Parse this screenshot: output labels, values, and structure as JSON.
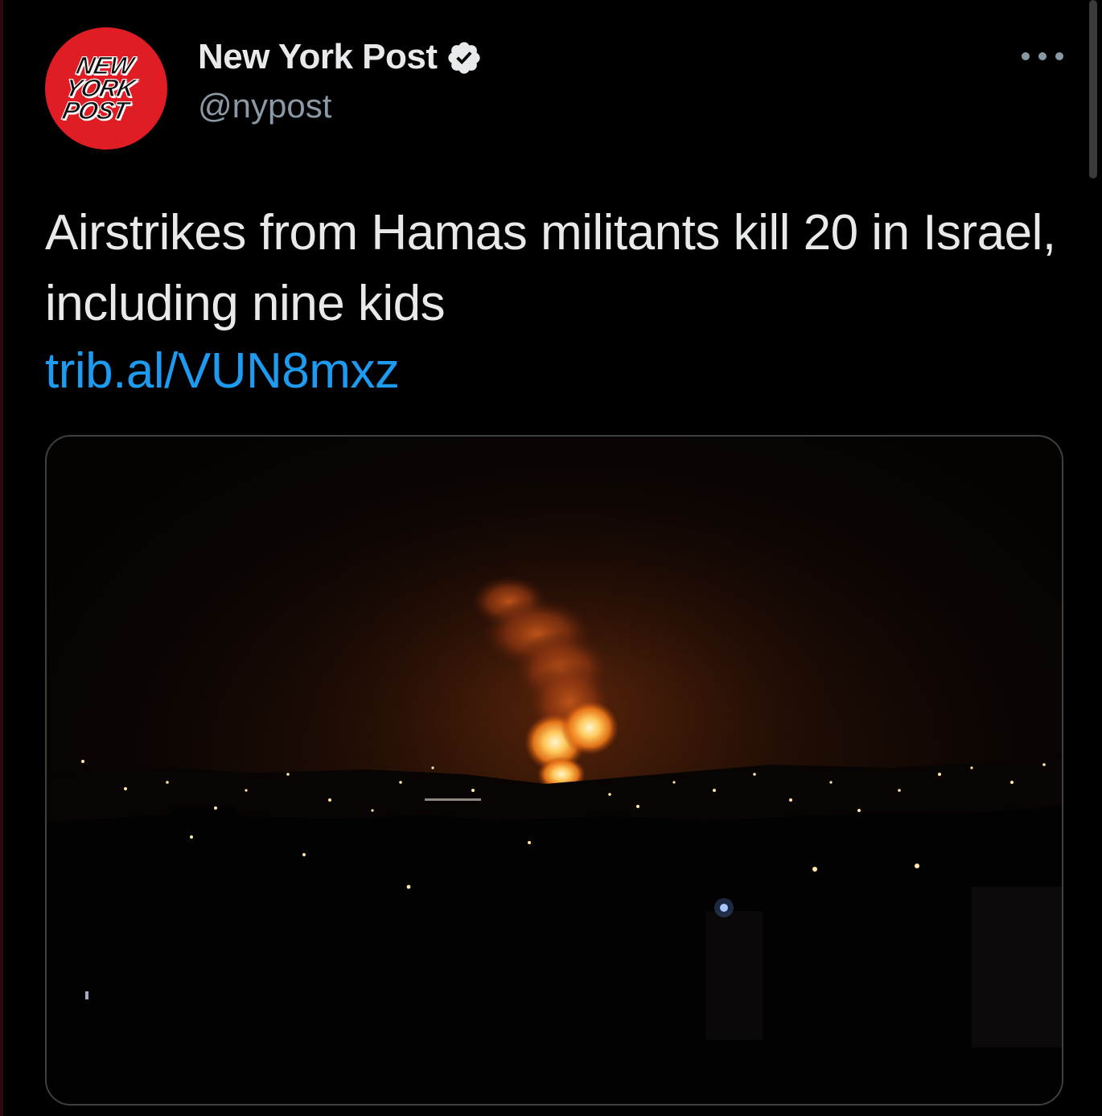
{
  "tweet": {
    "avatar": {
      "logo_lines": [
        "NEW",
        "YORK",
        "POST"
      ],
      "background_color": "#e01d24"
    },
    "author": {
      "display_name": "New York Post",
      "handle": "@nypost",
      "verified": true
    },
    "text": "Airstrikes from Hamas militants kill 20 in Israel, including nine kids",
    "link": "trib.al/VUN8mxz",
    "media": {
      "type": "photo",
      "subject": "night-explosion-over-city"
    },
    "icons": {
      "verified": "verified-badge-icon",
      "more": "more-options-icon"
    }
  },
  "colors": {
    "background": "#000000",
    "primary_text": "#e7e9ea",
    "secondary_text": "#8b98a5",
    "link": "#1d9bf0",
    "card_border": "#3e4144"
  }
}
